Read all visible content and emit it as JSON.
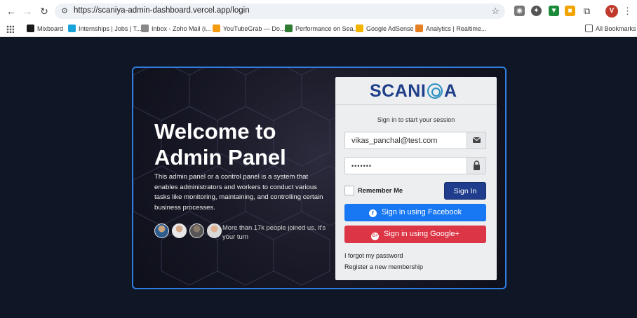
{
  "browser": {
    "url": "https://scaniya-admin-dashboard.vercel.app/login",
    "profile_initial": "V",
    "bookmarks": [
      {
        "label": "Mixboard",
        "color": "#1a1a1a"
      },
      {
        "label": "Internships | Jobs | T...",
        "color": "#1aa3d9"
      },
      {
        "label": "Inbox - Zoho Mail (i...",
        "color": "#888888"
      },
      {
        "label": "YouTubeGrab — Do...",
        "color": "#f39c12"
      },
      {
        "label": "Performance on Sea...",
        "color": "#2e7d32"
      },
      {
        "label": "Google AdSense",
        "color": "#f4b400"
      },
      {
        "label": "Analytics | Realtime...",
        "color": "#e67e22"
      }
    ],
    "all_bookmarks_label": "All Bookmarks"
  },
  "hero": {
    "title_line1": "Welcome to",
    "title_line2": "Admin Panel",
    "description": "This admin panel or a control panel is a system that enables administrators and workers to conduct various tasks like monitoring, maintaining, and controlling certain business processes.",
    "joined_text": "More than 17k people joined us, it's your turn"
  },
  "login": {
    "brand_left": "SCANI",
    "brand_right": "A",
    "session_text": "Sign in to start your session",
    "email_value": "vikas_panchal@test.com",
    "password_mask": "•••••••",
    "remember_label": "Remember Me",
    "signin_label": "Sign In",
    "facebook_label": "Sign in using Facebook",
    "google_label": "Sign in using Google+",
    "forgot_label": "I forgot my password",
    "register_label": "Register a new membership"
  },
  "colors": {
    "accent_blue": "#1f3d8c",
    "facebook_blue": "#1877f2",
    "google_red": "#dc3545",
    "card_border": "#2f7de1"
  }
}
